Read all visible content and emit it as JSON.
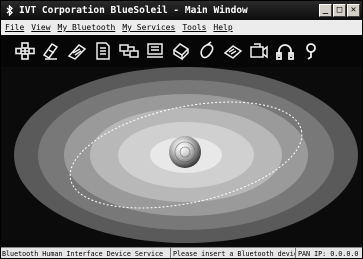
{
  "window": {
    "title": "IVT Corporation BlueSoleil - Main Window",
    "minimize_glyph": "_",
    "maximize_glyph": "□",
    "close_glyph": "✕"
  },
  "menu": {
    "items": [
      "File",
      "View",
      "My Bluetooth",
      "My Services",
      "Tools",
      "Help"
    ]
  },
  "toolbar": {
    "icons": [
      "network-access-icon",
      "file-transfer-icon",
      "sync-icon",
      "document-icon",
      "serial-port-icon",
      "fax-icon",
      "printer-icon",
      "mouse-icon",
      "headset-icon",
      "camera-icon",
      "audio-gateway-icon",
      "phone-icon"
    ]
  },
  "status": {
    "service": "Bluetooth Human Interface Device Service",
    "message": "Please insert a Bluetooth device",
    "pan_ip": "PAN IP: 0.0.0.0"
  }
}
